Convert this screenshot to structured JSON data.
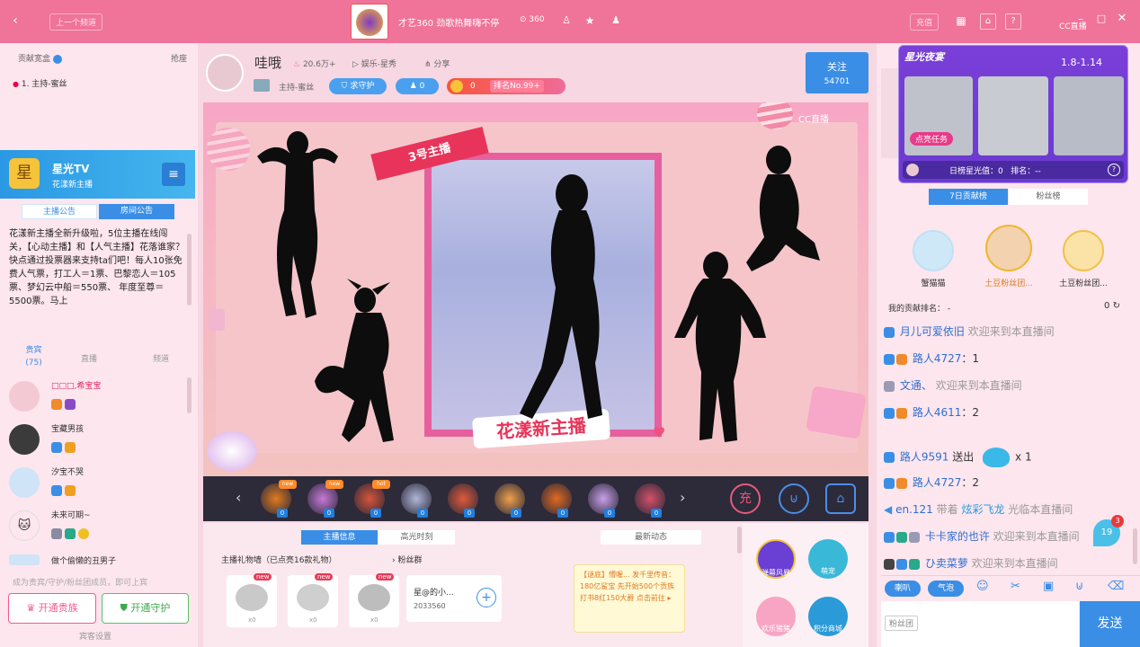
{
  "topbar": {
    "prev_room": "上一个频道",
    "title": "才艺360 劲歌热舞嗨不停",
    "viewers": "360",
    "recharge": "充值",
    "brand": "CC直播"
  },
  "left": {
    "rank_label": "贡献宽盒",
    "rank_action": "抢座",
    "rank_entry": "1. 主持-蜜丝",
    "banner_name": "星光TV",
    "banner_sub": "花漾新主播",
    "tab_host_notice": "主播公告",
    "tab_room_notice": "房间公告",
    "notice": "花漾新主播全新升级啦，5位主播在线闯关，【心动主播】和【人气主播】花落谁家？快点通过投票器来支持ta们吧！每人10张免费人气票，打工人＝1票、巴黎恋人＝105票、梦幻云中船＝550票、 年度至尊＝5500票。马上",
    "aud_tabs": [
      "贵宾\n(75)",
      "直播",
      "频道"
    ],
    "audience": [
      {
        "name": "□□□,希宝宝"
      },
      {
        "name": "宝藏男孩"
      },
      {
        "name": "汐宝不哭"
      },
      {
        "name": "未来可期~"
      },
      {
        "name": "做个偷懒的丑男子"
      }
    ],
    "hint": "成为贵宾/守护/粉丝团成员，即可上宾",
    "btn_vip": "开通贵族",
    "btn_guard": "开通守护",
    "settings": "宾客设置"
  },
  "host": {
    "name": "哇哦",
    "heat": "20.6万+",
    "category": "娱乐-星秀",
    "share": "分享",
    "sub": "主持-蜜丝",
    "guard": "求守护",
    "fans": "0",
    "rank_count": "0",
    "rank": "排名No.99+",
    "follow": "关注",
    "follow_count": "54701"
  },
  "stage": {
    "ribbon": "3号主播",
    "logo": "花漾新主播",
    "brand": "CC直播"
  },
  "gifts": [
    {
      "badge": "new"
    },
    {
      "badge": "new"
    },
    {
      "badge": "hot"
    },
    {
      "badge": ""
    },
    {
      "badge": ""
    },
    {
      "badge": ""
    },
    {
      "badge": ""
    },
    {
      "badge": ""
    },
    {
      "badge": ""
    }
  ],
  "gift_count": "0",
  "below": {
    "tab_info": "主播信息",
    "tab_moments": "高光时刻",
    "wall_title": "主播礼物墙（已点亮16款礼物）",
    "fan_group": "粉丝群",
    "gift_new": "new",
    "gift_counts": [
      "x0",
      "x0",
      "x0"
    ],
    "fan_name": "星@的小...",
    "fan_id": "2033560",
    "news_title": "最新动态",
    "news_text": "【谜底】懵喔... 发千里传音：180亿鲨宝 先开始500个贡族 打书8红150大爵 点击前往 ▸",
    "actions": [
      "弹幕风暴",
      "萌宠",
      "欢乐猪猪",
      "积分商城"
    ]
  },
  "right": {
    "event_title": "星光夜宴",
    "event_dates": "1.8-1.14",
    "event_task": "点亮任务",
    "event_status": "日榜星光值：0   排名：--",
    "tab_week": "7日贡献榜",
    "tab_fans": "粉丝榜",
    "top3": [
      "蟹猫猫",
      "土豆粉丝团...",
      "土豆粉丝团..."
    ],
    "my_rank": "我的贡献排名： -",
    "my_rank_val": "0",
    "chat": [
      {
        "name": "月儿可爱依旧",
        "msg": "欢迎来到本直播间"
      },
      {
        "name": "路人4727",
        "msg": "：1"
      },
      {
        "name": "文通、",
        "msg": "欢迎来到本直播间"
      },
      {
        "name": "路人4611",
        "msg": "：2"
      },
      {
        "name": "路人9591",
        "msg": "送出",
        "qty": "x 1"
      },
      {
        "name": "路人4727",
        "msg": "：2"
      },
      {
        "name": "en.121",
        "msg": "带着",
        "extra": "炫彩飞龙",
        "tail": "光临本直播间"
      },
      {
        "name": "卡卡家的也许",
        "msg": "欢迎来到本直播间"
      },
      {
        "name": "ひ卖菜萝",
        "msg": "欢迎来到本直播间"
      }
    ],
    "badge_num": "3",
    "drop_num": "19",
    "tool_danmu": "喇叭",
    "tool_bubble": "气泡",
    "fan_tag": "粉丝团",
    "send": "发送"
  },
  "colors": {
    "pink": "#f0739a",
    "accent": "#f25b8a",
    "blue": "#3a8ee6",
    "dark": "#2d2a3a"
  }
}
